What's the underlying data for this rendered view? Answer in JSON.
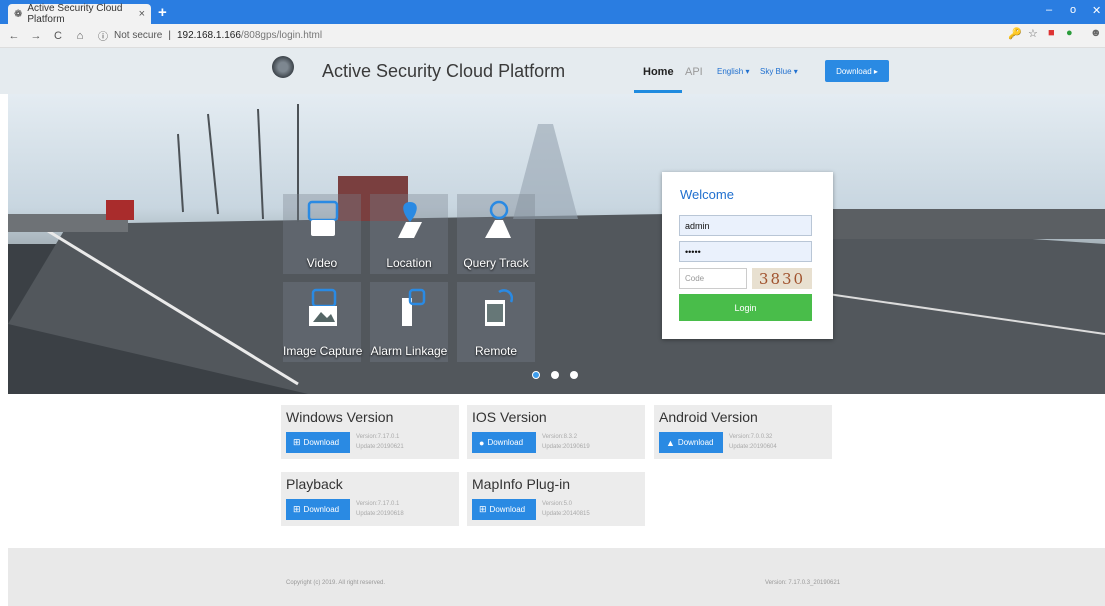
{
  "browser": {
    "tab_title": "Active Security Cloud Platform",
    "tab_close": "×",
    "new_tab": "+",
    "not_secure": "Not secure",
    "separator": "|",
    "url_host": "192.168.1.166",
    "url_path": "/808gps/login.html",
    "minimize": "–",
    "maximize": "o",
    "close": "✕",
    "back": "←",
    "forward": "→",
    "reload": "C",
    "home": "⌂"
  },
  "header": {
    "title": "Active Security Cloud Platform",
    "nav_home": "Home",
    "nav_api": "API",
    "language": "English ▾",
    "skin": "Sky Blue ▾",
    "download": "Download ▸"
  },
  "features": [
    {
      "label": "Video",
      "icon": "video-icon"
    },
    {
      "label": "Location",
      "icon": "location-icon"
    },
    {
      "label": "Query Track",
      "icon": "track-icon"
    },
    {
      "label": "Image Capture",
      "icon": "camera-icon"
    },
    {
      "label": "Alarm Linkage",
      "icon": "alarm-icon"
    },
    {
      "label": "Remote",
      "icon": "remote-icon"
    }
  ],
  "slider": {
    "current": 1,
    "count": 3
  },
  "login": {
    "welcome": "Welcome",
    "username": "admin",
    "password": "•••••",
    "code_placeholder": "Code",
    "captcha": "3830",
    "button": "Login"
  },
  "downloads": [
    {
      "title": "Windows Version",
      "button": "Download",
      "version": "Version:7.17.0.1",
      "update": "Update:20190621",
      "icon": "windows-icon"
    },
    {
      "title": "IOS Version",
      "button": "Download",
      "version": "Version:8.3.2",
      "update": "Update:20190619",
      "icon": "apple-icon"
    },
    {
      "title": "Android Version",
      "button": "Download",
      "version": "Version:7.0.0.32",
      "update": "Update:20190604",
      "icon": "android-icon"
    },
    {
      "title": "Playback",
      "button": "Download",
      "version": "Version:7.17.0.1",
      "update": "Update:20190618",
      "icon": "windows-icon"
    },
    {
      "title": "MapInfo Plug-in",
      "button": "Download",
      "version": "Version:5.0",
      "update": "Update:20140815",
      "icon": "windows-icon"
    }
  ],
  "footer": {
    "copyright": "Copyright (c) 2019. All right reserved.",
    "version": "Version: 7.17.0.3_20190621"
  },
  "colors": {
    "accent": "#2a8ae3",
    "login_button": "#49bd4a",
    "tab_bar": "#2a7de1"
  }
}
